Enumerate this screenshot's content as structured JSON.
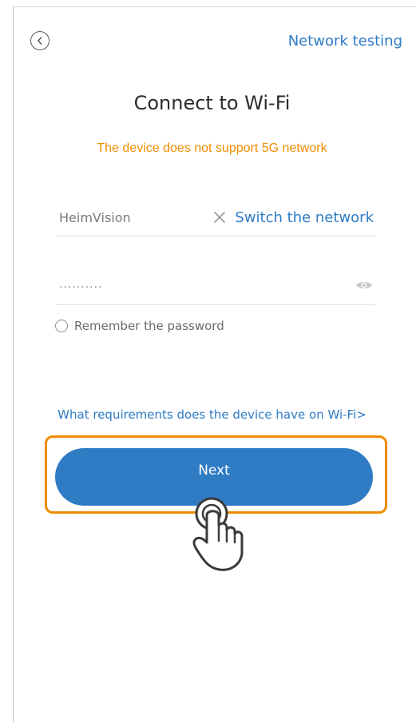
{
  "header": {
    "back_icon": "chevron-left-icon",
    "network_testing": "Network testing"
  },
  "main": {
    "title": "Connect to Wi-Fi",
    "warning": "The device does not support 5G network",
    "ssid": {
      "value": "HeimVision",
      "clear_icon": "close-icon",
      "switch_label": "Switch the network"
    },
    "password": {
      "value": "..........",
      "eye_icon": "eye-icon"
    },
    "remember_label": "Remember the password",
    "requirements_link": "What requirements does the device have on Wi-Fi>",
    "next_label": "Next"
  },
  "overlay": {
    "pointer_icon": "hand-pointer-icon",
    "highlight_color": "#f08c00"
  },
  "colors": {
    "accent": "#2e7bc5",
    "button": "#2f7bc4",
    "warning": "#f08c00"
  }
}
